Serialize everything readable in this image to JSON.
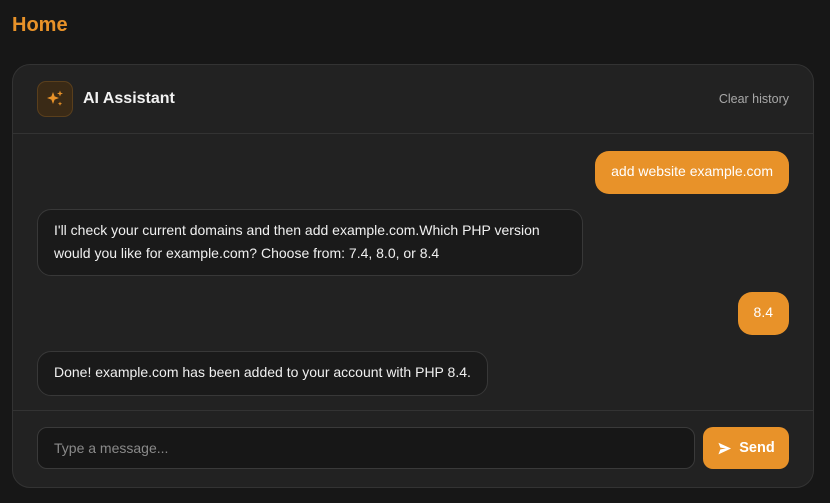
{
  "page": {
    "title": "Home"
  },
  "assistant": {
    "title": "AI Assistant",
    "icon": "sparkles-icon",
    "clear_history_label": "Clear history"
  },
  "messages": [
    {
      "role": "user",
      "text": "add website example.com"
    },
    {
      "role": "assistant",
      "text": "I'll check your current domains and then add example.com.Which PHP version would you like for example.com? Choose from: 7.4, 8.0, or 8.4"
    },
    {
      "role": "user",
      "text": "8.4"
    },
    {
      "role": "assistant",
      "text": "Done! example.com has been added to your account with PHP 8.4."
    }
  ],
  "composer": {
    "placeholder": "Type a message...",
    "value": "",
    "send_label": "Send",
    "send_icon": "send-icon"
  },
  "colors": {
    "accent": "#e89229",
    "background": "#171717",
    "card": "#222222"
  }
}
